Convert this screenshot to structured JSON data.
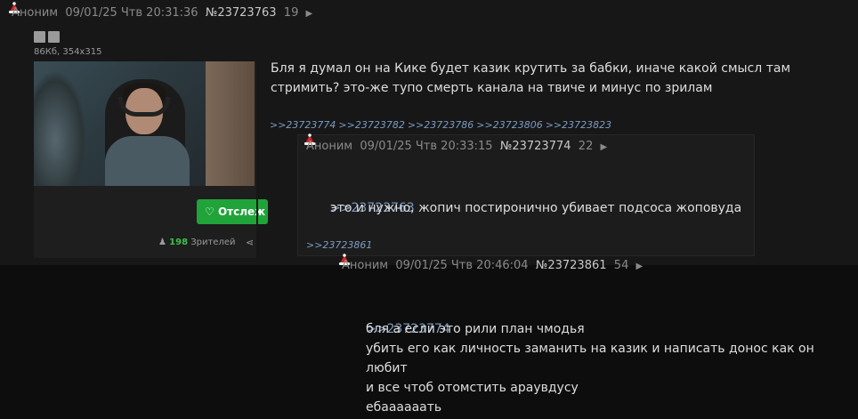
{
  "post1": {
    "author": "Аноним",
    "date": "09/01/25 Чтв 20:31:36",
    "number": "№23723763",
    "reply_count": "19",
    "file_meta": "86Кб, 354x315",
    "follow_label": "Отслеж",
    "viewers_count": "198",
    "viewers_label": "Зрителей",
    "text": "Бля я думал он на Кике будет казик крутить за бабки, иначе какой смысл там\nстримить? это-же тупо смерть канала на твиче и минус по зрилам",
    "reflinks": [
      ">>23723774",
      ">>23723782",
      ">>23723786",
      ">>23723806",
      ">>23723823"
    ]
  },
  "post2": {
    "author": "Аноним",
    "date": "09/01/25 Чтв 20:33:15",
    "number": "№23723774",
    "reply_count": "22",
    "quote": ">>23723763",
    "text": "это и нужно, жопич постиронично убивает подсоса жоповуда",
    "reflink": ">>23723861"
  },
  "post3": {
    "author": "Аноним",
    "date": "09/01/25 Чтв 20:46:04",
    "number": "№23723861",
    "reply_count": "54",
    "quote": ">>23723774",
    "text": "бля а если это рили план чмодья\nубить его как личность заманить на казик и написать донос как он любит\nи все чтоб отомстить араувдусу\nебаааааать"
  },
  "icons": {
    "hat": "santa-hat-icon",
    "expand": "triangle-right-icon",
    "share": "share-icon",
    "viewers": "people-icon",
    "heart": "heart-icon"
  },
  "colors": {
    "link": "#7b9bc2",
    "follow_button": "#20a43a",
    "viewers_count": "#39c04f"
  }
}
